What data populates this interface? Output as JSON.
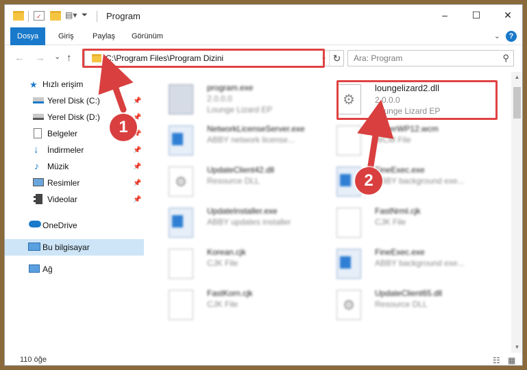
{
  "window": {
    "title": "Program",
    "controls": {
      "minimize": "–",
      "maximize": "☐",
      "close": "✕"
    }
  },
  "ribbon": {
    "tabs": [
      {
        "label": "Dosya",
        "active": true
      },
      {
        "label": "Giriş",
        "active": false
      },
      {
        "label": "Paylaş",
        "active": false
      },
      {
        "label": "Görünüm",
        "active": false
      }
    ],
    "help": "?"
  },
  "navigation": {
    "back": "←",
    "forward": "→",
    "recent": "⌄",
    "up": "↑",
    "address": "C:\\Program Files\\Program Dizini",
    "refresh": "↻",
    "search_placeholder": "Ara: Program"
  },
  "sidebar": {
    "items": [
      {
        "label": "Hızlı erişim",
        "icon": "star-icon",
        "pinned": false,
        "indent": 0
      },
      {
        "label": "Yerel Disk (C:)",
        "icon": "drive-icon",
        "pinned": true,
        "indent": 1
      },
      {
        "label": "Yerel Disk (D:)",
        "icon": "drive-icon",
        "pinned": true,
        "indent": 1
      },
      {
        "label": "Belgeler",
        "icon": "documents-icon",
        "pinned": true,
        "indent": 1
      },
      {
        "label": "İndirmeler",
        "icon": "downloads-icon",
        "pinned": true,
        "indent": 1
      },
      {
        "label": "Müzik",
        "icon": "music-icon",
        "pinned": true,
        "indent": 1
      },
      {
        "label": "Resimler",
        "icon": "pictures-icon",
        "pinned": true,
        "indent": 1
      },
      {
        "label": "Videolar",
        "icon": "videos-icon",
        "pinned": true,
        "indent": 1
      },
      {
        "label": "OneDrive",
        "icon": "cloud-icon",
        "pinned": false,
        "indent": 0
      },
      {
        "label": "Bu bilgisayar",
        "icon": "computer-icon",
        "pinned": false,
        "indent": 0,
        "selected": true
      },
      {
        "label": "Ağ",
        "icon": "network-icon",
        "pinned": false,
        "indent": 0
      }
    ]
  },
  "files": [
    {
      "name": "program.exe",
      "line2": "2.0.0.0",
      "line3": "Lounge Lizard EP",
      "icon": "installer-icon",
      "blurred": true
    },
    {
      "name": "loungelizard2.dll",
      "line2": "2.0.0.0",
      "line3": "Lounge Lizard EP",
      "icon": "dll-gear-icon",
      "blurred": false,
      "highlighted": true
    },
    {
      "name": "NetworkLicenseServer.exe",
      "line2": "ABBY network license...",
      "icon": "exe-icon",
      "blurred": true
    },
    {
      "name": "PaperWP12.wcm",
      "line2": "WCM File",
      "icon": "document-icon",
      "blurred": true
    },
    {
      "name": "UpdateClient42.dll",
      "line2": "Resource DLL",
      "icon": "dll-gear-icon",
      "blurred": true
    },
    {
      "name": "FineExec.exe",
      "line2": "ABBY background exe...",
      "icon": "exe-icon",
      "blurred": true
    },
    {
      "name": "UpdateInstaller.exe",
      "line2": "ABBY updates installer",
      "icon": "exe-icon",
      "blurred": true
    },
    {
      "name": "FastNrml.cjk",
      "line2": "CJK File",
      "icon": "document-icon",
      "blurred": true
    },
    {
      "name": "Korean.cjk",
      "line2": "CJK File",
      "icon": "document-icon",
      "blurred": true
    },
    {
      "name": "FineExec.exe",
      "line2": "ABBY background exe...",
      "icon": "exe-icon",
      "blurred": true
    },
    {
      "name": "FastKorn.cjk",
      "line2": "CJK File",
      "icon": "document-icon",
      "blurred": true
    },
    {
      "name": "UpdateClient65.dll",
      "line2": "Resource DLL",
      "icon": "dll-gear-icon",
      "blurred": true
    }
  ],
  "status": {
    "item_count": "110 öğe"
  },
  "annotations": [
    {
      "number": "1",
      "color": "#d93f3f"
    },
    {
      "number": "2",
      "color": "#d93f3f"
    }
  ]
}
